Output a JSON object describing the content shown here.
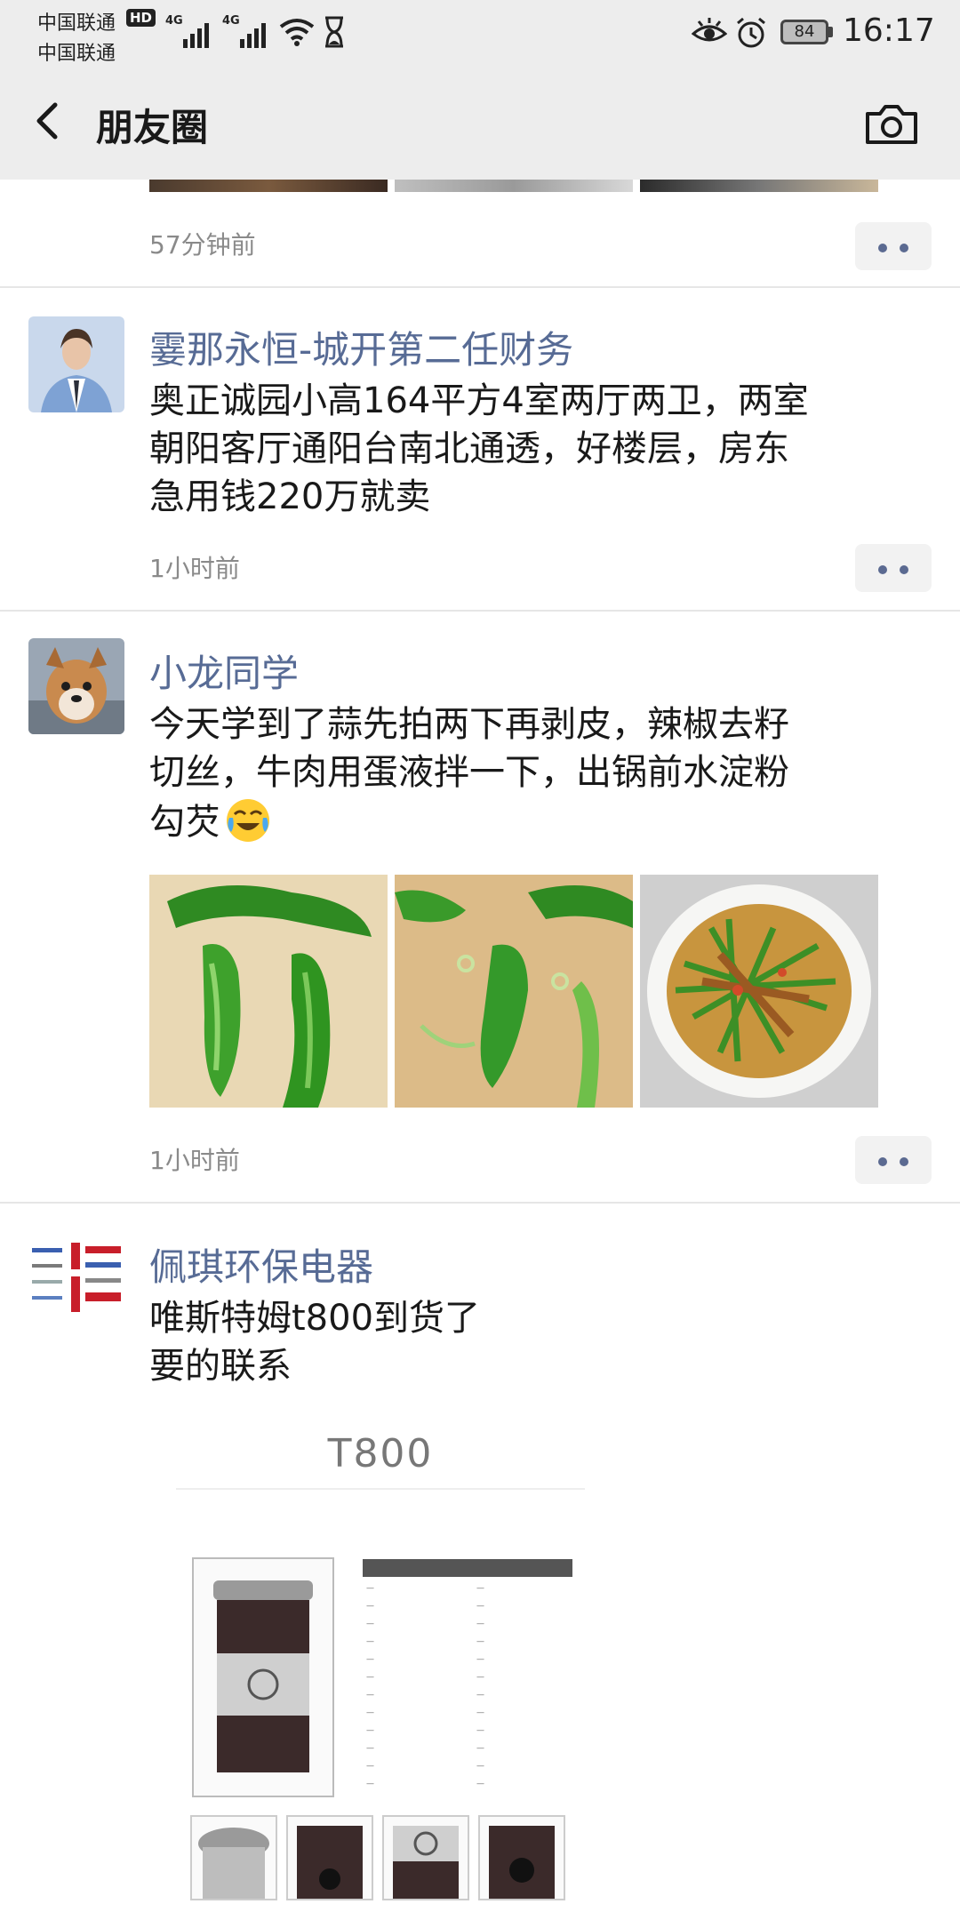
{
  "status_bar": {
    "carrier_1": "中国联通",
    "carrier_2": "中国联通",
    "hd_badge": "HD",
    "signal_1_label": "4G",
    "signal_2_label": "4G",
    "battery": "84",
    "time": "16:17"
  },
  "nav": {
    "title": "朋友圈"
  },
  "posts": [
    {
      "time": "57分钟前"
    },
    {
      "author": "霎那永恒-城开第二任财务",
      "lines": [
        "奥正诚园小高164平方4室两厅两卫，两室",
        "朝阳客厅通阳台南北通透，好楼层，房东",
        "急用钱220万就卖"
      ],
      "time": "1小时前"
    },
    {
      "author": "小龙同学",
      "lines": [
        "今天学到了蒜先拍两下再剥皮，辣椒去籽",
        "切丝，牛肉用蛋液拌一下，出锅前水淀粉",
        "勾芡"
      ],
      "time": "1小时前"
    },
    {
      "author": "佩琪环保电器",
      "lines": [
        "唯斯特姆t800到货了",
        "要的联系"
      ],
      "product_title": "T800"
    }
  ],
  "colors": {
    "author_link": "#576b95",
    "bar_bg": "#ededed",
    "time_gray": "#8a8a8a"
  }
}
